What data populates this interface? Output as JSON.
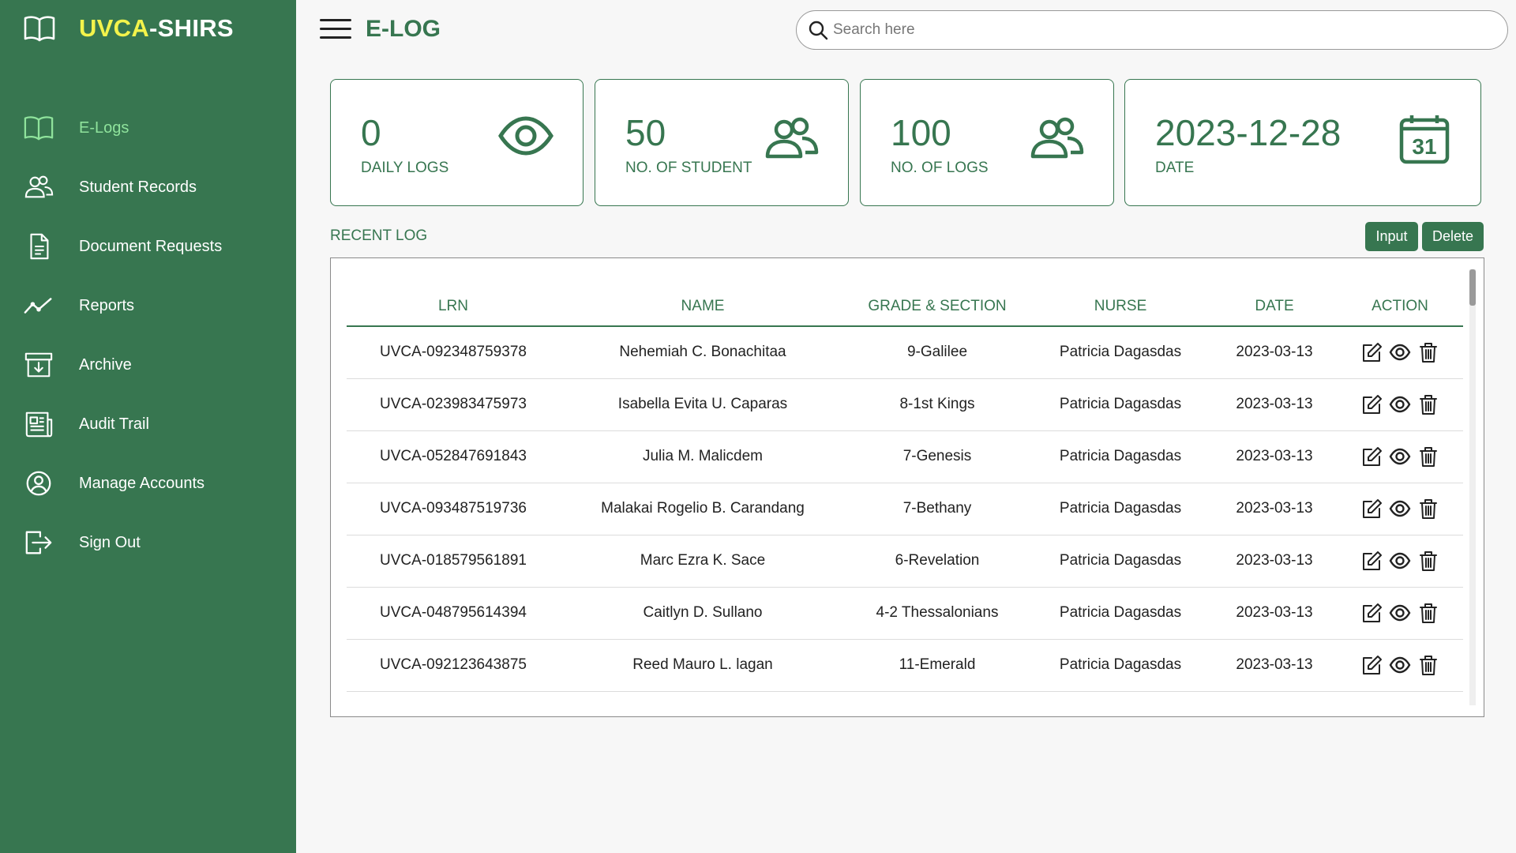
{
  "brand": {
    "part1": "UVCA",
    "part2": "-SHIRS"
  },
  "sidebar": {
    "items": [
      {
        "label": "E-Logs",
        "icon": "book-icon",
        "active": true
      },
      {
        "label": "Student Records",
        "icon": "users-icon"
      },
      {
        "label": "Document Requests",
        "icon": "document-icon"
      },
      {
        "label": "Reports",
        "icon": "line-chart-icon"
      },
      {
        "label": "Archive",
        "icon": "archive-icon"
      },
      {
        "label": "Audit Trail",
        "icon": "newspaper-icon"
      },
      {
        "label": "Manage Accounts",
        "icon": "user-circle-icon"
      },
      {
        "label": "Sign Out",
        "icon": "sign-out-icon"
      }
    ]
  },
  "header": {
    "title": "E-LOG",
    "search_placeholder": "Search here"
  },
  "cards": [
    {
      "value": "0",
      "caption": "DAILY LOGS",
      "icon": "eye-icon"
    },
    {
      "value": "50",
      "caption": "NO. OF STUDENT",
      "icon": "users-icon"
    },
    {
      "value": "100",
      "caption": "NO. OF LOGS",
      "icon": "users-icon"
    },
    {
      "value": "2023-12-28",
      "caption": "DATE",
      "icon": "calendar-icon",
      "calendar_day": "31"
    }
  ],
  "recent": {
    "title": "RECENT LOG",
    "input_label": "Input",
    "delete_label": "Delete",
    "columns": [
      "LRN",
      "NAME",
      "GRADE & SECTION",
      "NURSE",
      "DATE",
      "ACTION"
    ],
    "rows": [
      {
        "lrn": "UVCA-092348759378",
        "name": "Nehemiah C. Bonachitaa",
        "grade": "9-Galilee",
        "nurse": "Patricia Dagasdas",
        "date": "2023-03-13"
      },
      {
        "lrn": "UVCA-023983475973",
        "name": "Isabella Evita U. Caparas",
        "grade": "8-1st Kings",
        "nurse": "Patricia Dagasdas",
        "date": "2023-03-13"
      },
      {
        "lrn": "UVCA-052847691843",
        "name": "Julia M. Malicdem",
        "grade": "7-Genesis",
        "nurse": "Patricia Dagasdas",
        "date": "2023-03-13"
      },
      {
        "lrn": "UVCA-093487519736",
        "name": "Malakai Rogelio B. Carandang",
        "grade": "7-Bethany",
        "nurse": "Patricia Dagasdas",
        "date": "2023-03-13"
      },
      {
        "lrn": "UVCA-018579561891",
        "name": "Marc Ezra K. Sace",
        "grade": "6-Revelation",
        "nurse": "Patricia Dagasdas",
        "date": "2023-03-13"
      },
      {
        "lrn": "UVCA-048795614394",
        "name": "Caitlyn D. Sullano",
        "grade": "4-2 Thessalonians",
        "nurse": "Patricia Dagasdas",
        "date": "2023-03-13"
      },
      {
        "lrn": "UVCA-092123643875",
        "name": "Reed Mauro L. lagan",
        "grade": "11-Emerald",
        "nurse": "Patricia Dagasdas",
        "date": "2023-03-13"
      }
    ]
  },
  "colors": {
    "primary": "#377650",
    "brand_yellow": "#f3f34b",
    "active_nav": "#8fe39c",
    "background": "#f7f7f7"
  }
}
